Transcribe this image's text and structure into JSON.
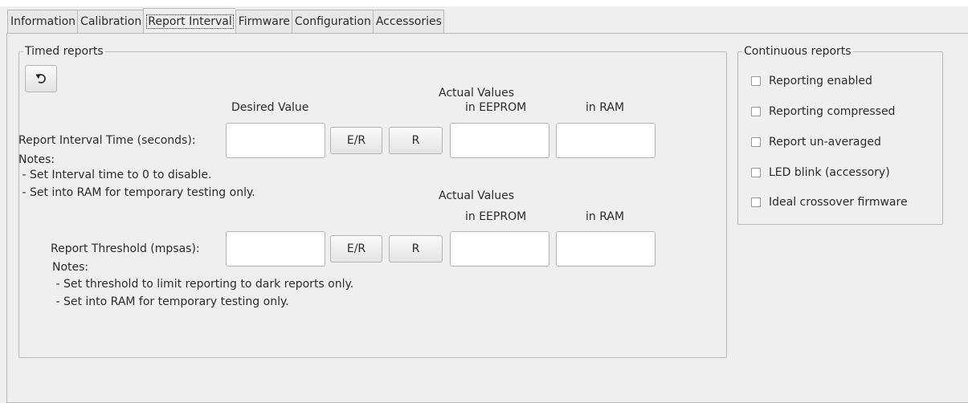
{
  "tabs": [
    {
      "label": "Information",
      "active": false
    },
    {
      "label": "Calibration",
      "active": false
    },
    {
      "label": "Report Interval",
      "active": true
    },
    {
      "label": "Firmware",
      "active": false
    },
    {
      "label": "Configuration",
      "active": false
    },
    {
      "label": "Accessories",
      "active": false
    }
  ],
  "timed_reports": {
    "title": "Timed reports",
    "undo_icon": "undo-icon",
    "interval": {
      "desired_header": "Desired Value",
      "actual_header": "Actual Values",
      "eeprom_header": "in EEPROM",
      "ram_header": "in RAM",
      "label": "Report Interval Time (seconds):",
      "desired_value": "",
      "er_button": "E/R",
      "r_button": "R",
      "eeprom_value": "",
      "ram_value": "",
      "notes_title": "Notes:",
      "notes": [
        " - Set Interval time to 0 to disable.",
        " - Set into RAM for temporary testing only."
      ]
    },
    "threshold": {
      "actual_header": "Actual Values",
      "eeprom_header": "in EEPROM",
      "ram_header": "in RAM",
      "label": "Report Threshold (mpsas):",
      "desired_value": "",
      "er_button": "E/R",
      "r_button": "R",
      "eeprom_value": "",
      "ram_value": "",
      "notes_title": "Notes:",
      "notes": [
        " - Set threshold to limit reporting to dark reports only.",
        " - Set into RAM for temporary testing only."
      ]
    }
  },
  "continuous_reports": {
    "title": "Continuous reports",
    "options": [
      {
        "label": "Reporting enabled",
        "checked": false
      },
      {
        "label": "Reporting compressed",
        "checked": false
      },
      {
        "label": "Report un-averaged",
        "checked": false
      },
      {
        "label": "LED blink (accessory)",
        "checked": false
      },
      {
        "label": "Ideal crossover firmware",
        "checked": false
      }
    ]
  }
}
